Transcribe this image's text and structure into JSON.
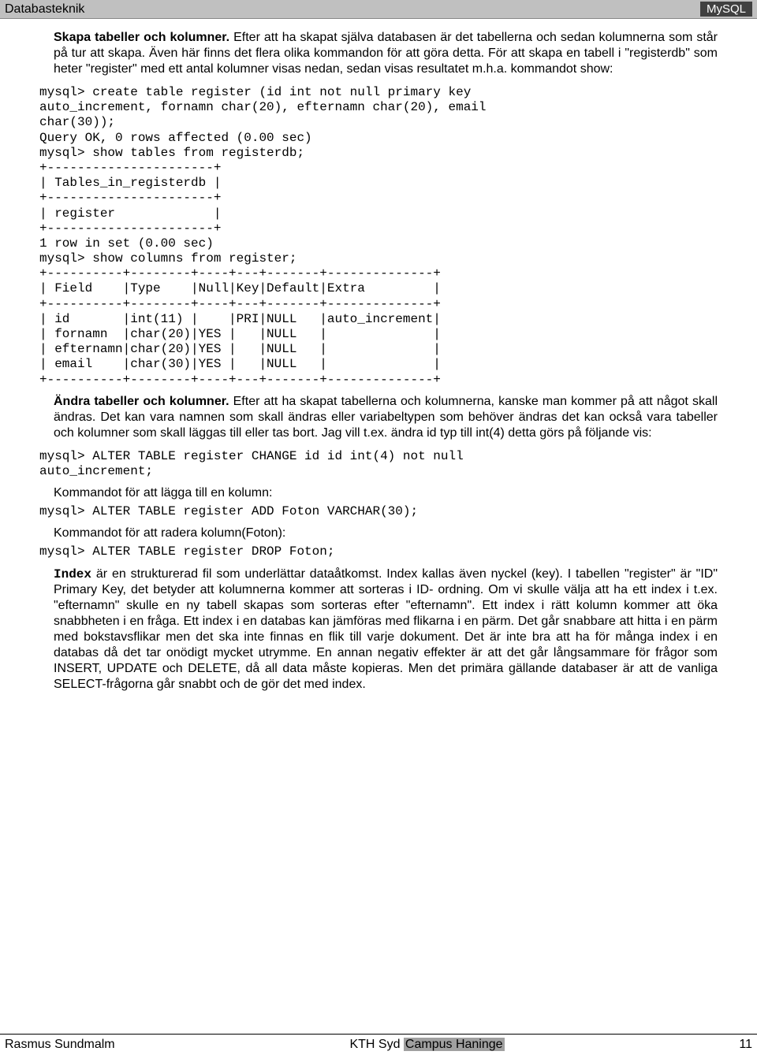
{
  "header": {
    "left": "Databasteknik",
    "right": "MySQL"
  },
  "p1_title": "Skapa tabeller och kolumner.",
  "p1": " Efter att ha skapat själva databasen är det tabellerna och sedan kolumnerna som står på tur att skapa. Även här finns det flera olika kommandon för att göra detta. För att skapa en tabell i \"registerdb\" som heter \"register\" med ett antal kolumner visas nedan, sedan visas resultatet m.h.a. kommandot show:",
  "code1": "mysql> create table register (id int not null primary key\nauto_increment, fornamn char(20), efternamn char(20), email\nchar(30));\nQuery OK, 0 rows affected (0.00 sec)\nmysql> show tables from registerdb;\n+----------------------+\n| Tables_in_registerdb |\n+----------------------+\n| register             |\n+----------------------+\n1 row in set (0.00 sec)\nmysql> show columns from register;\n+----------+--------+----+---+-------+--------------+\n| Field    |Type    |Null|Key|Default|Extra         |\n+----------+--------+----+---+-------+--------------+\n| id       |int(11) |    |PRI|NULL   |auto_increment|\n| fornamn  |char(20)|YES |   |NULL   |              |\n| efternamn|char(20)|YES |   |NULL   |              |\n| email    |char(30)|YES |   |NULL   |              |\n+----------+--------+----+---+-------+--------------+",
  "p2_title": "Ändra tabeller och kolumner.",
  "p2": " Efter att ha skapat tabellerna och kolumnerna, kanske man kommer på att något skall ändras. Det kan vara namnen som skall ändras eller variabeltypen som behöver ändras det kan också vara tabeller och kolumner som skall läggas till eller tas bort. Jag vill t.ex. ändra id typ till int(4) detta görs på följande vis:",
  "code2": "mysql> ALTER TABLE register CHANGE id id int(4) not null\nauto_increment;",
  "p3": "Kommandot för att lägga till en kolumn:",
  "code3": "mysql> ALTER TABLE register ADD Foton VARCHAR(30);",
  "p4": "Kommandot för att radera kolumn(Foton):",
  "code4": "mysql> ALTER TABLE register DROP Foton;",
  "p5_title": "Index",
  "p5": " är en strukturerad fil som underlättar dataåtkomst. Index kallas även nyckel (key). I tabellen \"register\" är \"ID\" Primary Key, det betyder att kolumnerna kommer att sorteras i ID- ordning. Om vi skulle välja att ha ett index i t.ex. \"efternamn\" skulle en ny tabell skapas som sorteras efter \"efternamn\". Ett index i rätt kolumn kommer att öka snabbheten i en fråga. Ett index i en databas kan jämföras med flikarna i en pärm. Det går snabbare att hitta i en pärm med bokstavsflikar men det ska inte finnas en flik till varje dokument. Det är inte bra att ha för många index i en databas då det tar onödigt mycket utrymme. En annan negativ effekter är att det går långsammare för frågor som INSERT, UPDATE och DELETE, då all data måste kopieras. Men det primära gällande databaser är att de vanliga SELECT-frågorna går snabbt och de gör det med index.",
  "footer": {
    "left": "Rasmus Sundmalm",
    "center_plain": "KTH Syd ",
    "center_hl": "Campus Haninge",
    "right": "11"
  }
}
